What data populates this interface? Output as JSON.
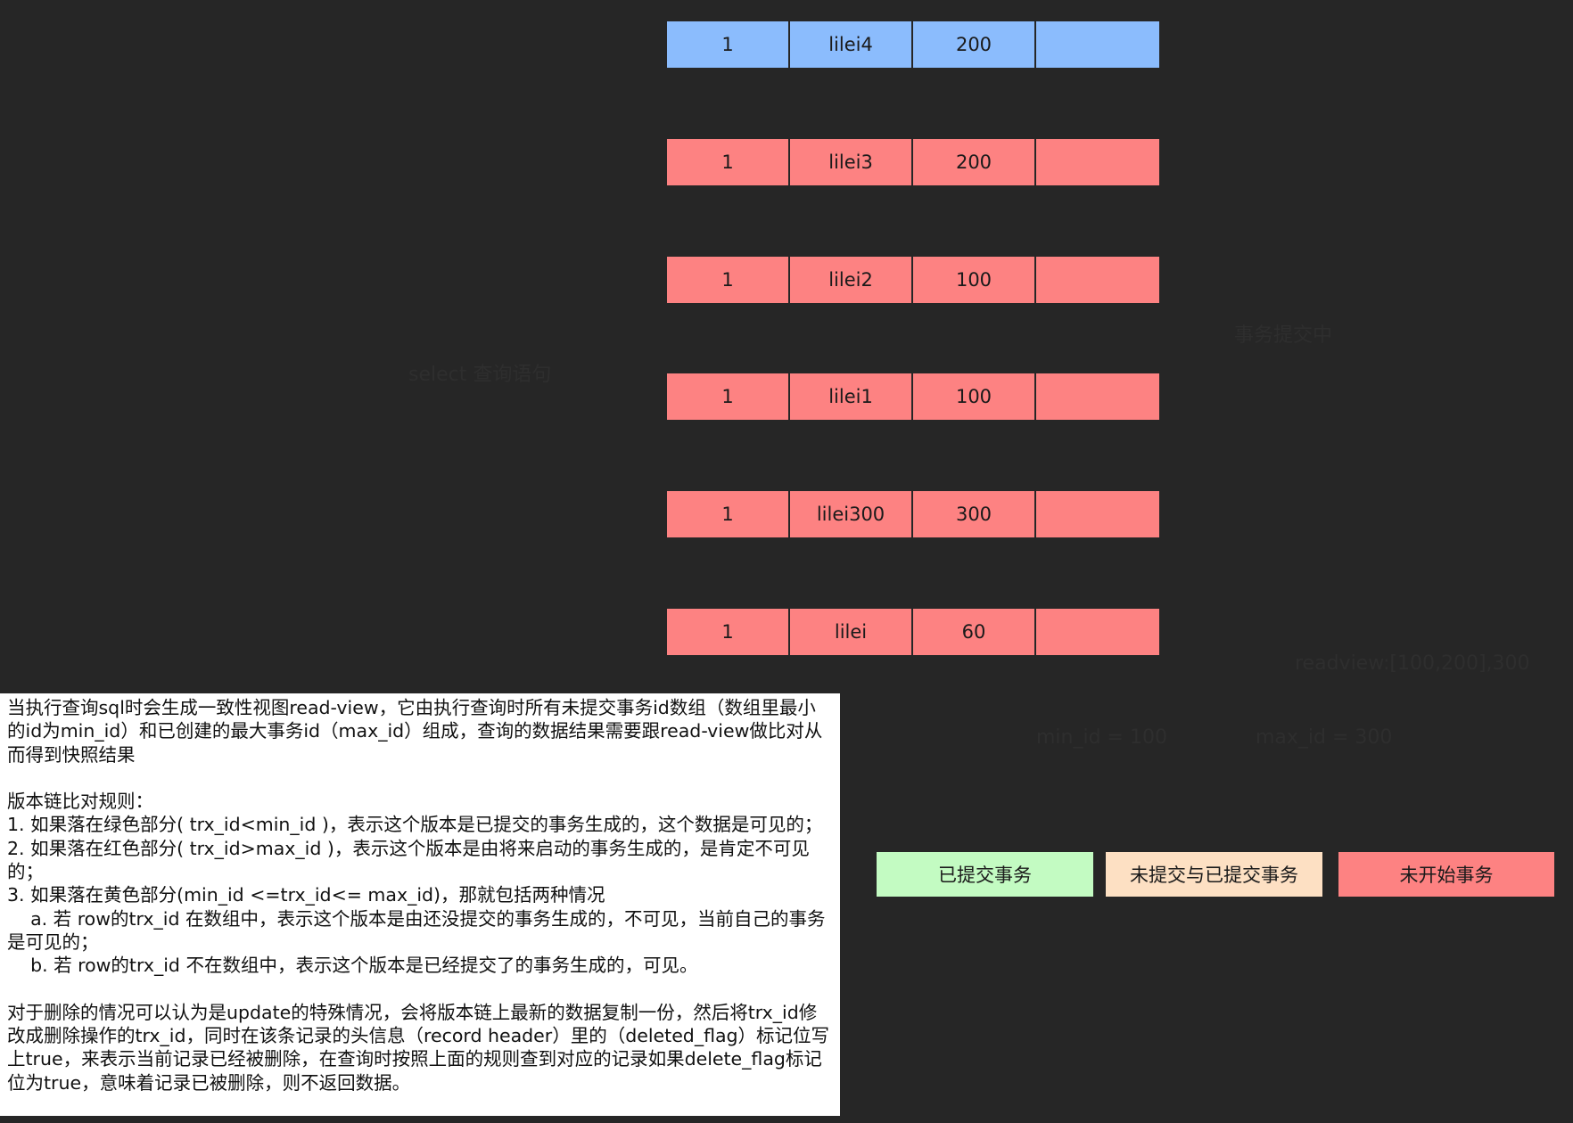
{
  "colors": {
    "background": "#262626",
    "current_version": "#8bbcfd",
    "committed": "#c3fbc2",
    "mixed": "#fde0c3",
    "not_started": "#fd8282"
  },
  "version_chain": [
    {
      "id": "1",
      "name": "lilei4",
      "trx_id": "200",
      "roll_pointer": "",
      "color": "blue"
    },
    {
      "id": "1",
      "name": "lilei3",
      "trx_id": "200",
      "roll_pointer": "",
      "color": "red"
    },
    {
      "id": "1",
      "name": "lilei2",
      "trx_id": "100",
      "roll_pointer": "",
      "color": "red"
    },
    {
      "id": "1",
      "name": "lilei1",
      "trx_id": "100",
      "roll_pointer": "",
      "color": "red"
    },
    {
      "id": "1",
      "name": "lilei300",
      "trx_id": "300",
      "roll_pointer": "",
      "color": "red"
    },
    {
      "id": "1",
      "name": "lilei",
      "trx_id": "60",
      "roll_pointer": "",
      "color": "red"
    }
  ],
  "faint_labels": {
    "left_label": "select 查询语句",
    "right_label": "事务提交中",
    "read_view": "readview:[100,200],300",
    "min_id": "min_id = 100",
    "max_id": "max_id = 300"
  },
  "legend": [
    {
      "label": "已提交事务",
      "color": "#c3fbc2"
    },
    {
      "label": "未提交与已提交事务",
      "color": "#fde0c3"
    },
    {
      "label": "未开始事务",
      "color": "#fd8282"
    }
  ],
  "notes": [
    "当执行查询sql时会生成一致性视图read-view，它由执行查询时所有未提交事务id数组（数组里最小的id为min_id）和已创建的最大事务id（max_id）组成，查询的数据结果需要跟read-view做比对从而得到快照结果",
    "",
    "版本链比对规则：",
    "1. 如果落在绿色部分( trx_id<min_id )，表示这个版本是已提交的事务生成的，这个数据是可见的；",
    "2. 如果落在红色部分( trx_id>max_id )，表示这个版本是由将来启动的事务生成的，是肯定不可见的；",
    "3. 如果落在黄色部分(min_id <=trx_id<= max_id)，那就包括两种情况",
    "    a. 若 row的trx_id 在数组中，表示这个版本是由还没提交的事务生成的，不可见，当前自己的事务是可见的；",
    "    b. 若 row的trx_id 不在数组中，表示这个版本是已经提交了的事务生成的，可见。",
    "",
    "对于删除的情况可以认为是update的特殊情况，会将版本链上最新的数据复制一份，然后将trx_id修改成删除操作的trx_id，同时在该条记录的头信息（record header）里的（deleted_flag）标记位写上true，来表示当前记录已经被删除，在查询时按照上面的规则查到对应的记录如果delete_flag标记位为true，意味着记录已被删除，则不返回数据。"
  ]
}
